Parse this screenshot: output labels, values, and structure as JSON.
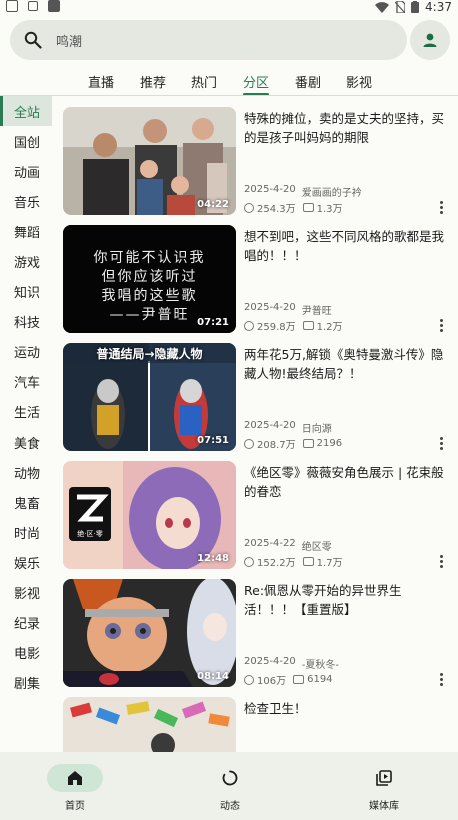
{
  "status_bar": {
    "time": "4:37"
  },
  "search": {
    "placeholder": "鸣潮"
  },
  "top_tabs": [
    "直播",
    "推荐",
    "热门",
    "分区",
    "番剧",
    "影视"
  ],
  "active_top_tab": "分区",
  "sidebar": [
    "全站",
    "国创",
    "动画",
    "音乐",
    "舞蹈",
    "游戏",
    "知识",
    "科技",
    "运动",
    "汽车",
    "生活",
    "美食",
    "动物",
    "鬼畜",
    "时尚",
    "娱乐",
    "影视",
    "纪录",
    "电影",
    "剧集"
  ],
  "active_sidebar": "全站",
  "videos": [
    {
      "title": "特殊的摊位，卖的是丈夫的坚持，买的是孩子叫妈妈的期限",
      "date": "2025-4-20",
      "author": "爱画画的子衿",
      "plays": "254.3万",
      "danmaku": "1.3万",
      "duration": "04:22",
      "thumb_text": ""
    },
    {
      "title": "想不到吧，这些不同风格的歌都是我唱的！！！",
      "date": "2025-4-20",
      "author": "尹普旺",
      "plays": "259.8万",
      "danmaku": "1.2万",
      "duration": "07:21",
      "thumb_text": "你可能不认识我\n但你应该听过\n我唱的这些歌\n——尹普旺"
    },
    {
      "title": "两年花5万,解锁《奥特曼激斗传》隐藏人物!最终结局？！",
      "date": "2025-4-20",
      "author": "日向源",
      "plays": "208.7万",
      "danmaku": "2196",
      "duration": "07:51",
      "thumb_text": "普通结局→隐藏人物"
    },
    {
      "title": "《绝区零》薇薇安角色展示 | 花束般的眷恋",
      "date": "2025-4-22",
      "author": "绝区零",
      "plays": "152.2万",
      "danmaku": "1.7万",
      "duration": "12:48",
      "thumb_text": "绝·区·零"
    },
    {
      "title": "Re:佩恩从零开始的异世界生活！！！【重置版】",
      "date": "2025-4-20",
      "author": "-夏秋冬-",
      "plays": "106万",
      "danmaku": "6194",
      "duration": "08:14",
      "thumb_text": ""
    },
    {
      "title": "检查卫生！",
      "date": "",
      "author": "",
      "plays": "",
      "danmaku": "",
      "duration": "",
      "thumb_text": ""
    }
  ],
  "bottom_nav": [
    {
      "label": "首页",
      "icon": "home-icon"
    },
    {
      "label": "动态",
      "icon": "dynamic-icon"
    },
    {
      "label": "媒体库",
      "icon": "media-library-icon"
    }
  ],
  "colors": {
    "accent": "#2a7a52",
    "background": "#fbfcf7",
    "search_bg": "#e5e8e1",
    "nav_active_pill": "#cfe6d6"
  }
}
